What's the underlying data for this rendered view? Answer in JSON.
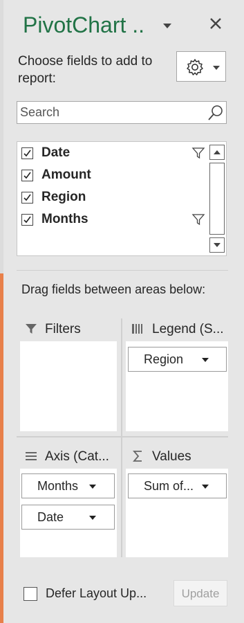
{
  "panel": {
    "title": "PivotChart ..",
    "choose_fields_text": "Choose fields to add to report:",
    "icons": {
      "title_menu": "chevron-down-icon",
      "close": "close-icon",
      "settings": "gear-icon"
    }
  },
  "search": {
    "placeholder": "Search",
    "icon": "search-icon"
  },
  "fields": [
    {
      "label": "Date",
      "checked": true,
      "filtered": true
    },
    {
      "label": "Amount",
      "checked": true,
      "filtered": false
    },
    {
      "label": "Region",
      "checked": true,
      "filtered": false
    },
    {
      "label": "Months",
      "checked": true,
      "filtered": true
    }
  ],
  "drag_instruction": "Drag fields between areas below:",
  "areas": {
    "filters": {
      "label": "Filters",
      "icon": "filter-icon",
      "items": []
    },
    "legend": {
      "label": "Legend (S...",
      "icon": "columns-icon",
      "items": [
        "Region"
      ]
    },
    "axis": {
      "label": "Axis (Cat...",
      "icon": "rows-icon",
      "items": [
        "Months",
        "Date"
      ]
    },
    "values": {
      "label": "Values",
      "icon": "sigma-icon",
      "items": [
        "Sum of..."
      ]
    }
  },
  "footer": {
    "defer_label": "Defer Layout Up...",
    "defer_checked": false,
    "update_label": "Update"
  },
  "colors": {
    "title": "#217346",
    "accent_edge": "#e8804a",
    "panel_bg": "#e6e6e6"
  }
}
